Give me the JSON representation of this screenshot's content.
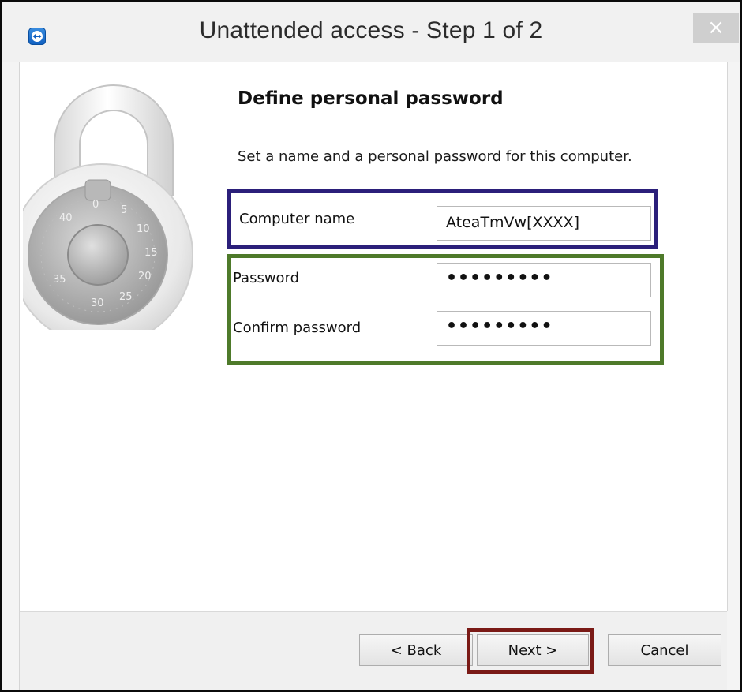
{
  "window": {
    "title": "Unattended access - Step 1 of 2",
    "close_label": "×"
  },
  "page": {
    "heading": "Define personal password",
    "description": "Set a name and a personal password for this computer."
  },
  "form": {
    "computer_name_label": "Computer name",
    "computer_name_value": "AteaTmVw[XXXX]",
    "password_label": "Password",
    "password_value": "•••••••••",
    "confirm_password_label": "Confirm password",
    "confirm_password_value": "•••••••••"
  },
  "lock_dial": {
    "numbers": [
      "0",
      "5",
      "10",
      "15",
      "20",
      "25",
      "30",
      "35",
      "40"
    ]
  },
  "buttons": {
    "back": "< Back",
    "next": "Next >",
    "cancel": "Cancel"
  },
  "colors": {
    "name_group_outline": "#2b1f7a",
    "password_group_outline": "#4e7a2a",
    "next_button_outline": "#7a1a16"
  }
}
